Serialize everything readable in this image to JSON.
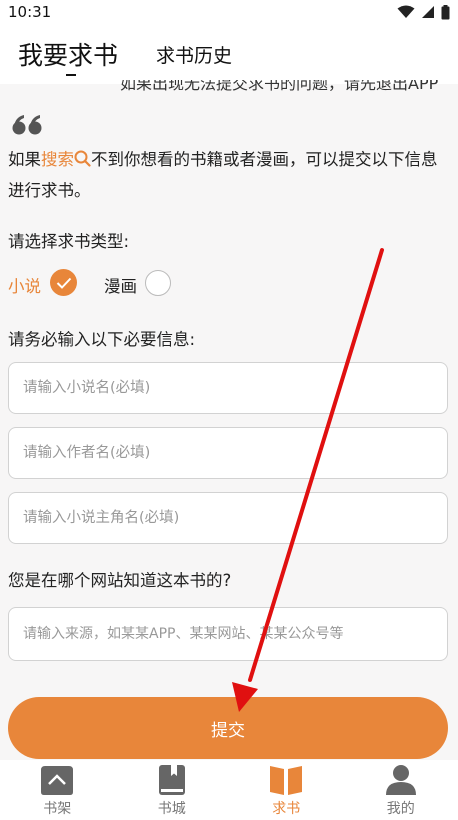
{
  "status_bar": {
    "time": "10:31"
  },
  "header": {
    "tab_main": "我要求书",
    "tab_history": "求书历史"
  },
  "notice_cut": "如果出现无法提交求书的问题，请先退出APP",
  "intro": {
    "before": "如果",
    "search_word": "搜索",
    "after": "不到你想看的书籍或者漫画，可以提交以下信息进行求书。"
  },
  "type_label": "请选择求书类型:",
  "options": {
    "novel": "小说",
    "comic": "漫画"
  },
  "required_label": "请务必输入以下必要信息:",
  "fields": {
    "novel_placeholder": "请输入小说名(必填)",
    "author_placeholder": "请输入作者名(必填)",
    "hero_placeholder": "请输入小说主角名(必填)"
  },
  "source_label": "您是在哪个网站知道这本书的?",
  "source_placeholder": "请输入来源，如某某APP、某某网站、某某公众号等",
  "submit_label": "提交",
  "nav": {
    "shelf": "书架",
    "city": "书城",
    "request": "求书",
    "mine": "我的"
  },
  "colors": {
    "accent": "#e8863a",
    "arrow": "#e01010"
  }
}
